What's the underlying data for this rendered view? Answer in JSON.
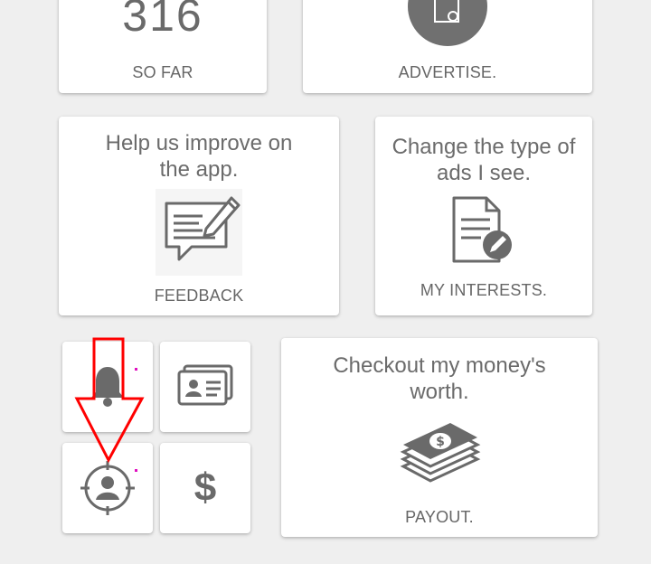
{
  "so_far": {
    "count": "316",
    "label": "SO FAR"
  },
  "advertise": {
    "label": "ADVERTISE."
  },
  "feedback": {
    "title": "Help us improve on the app.",
    "label": "FEEDBACK"
  },
  "interests": {
    "title": "Change the type of ads I see.",
    "label": "MY INTERESTS."
  },
  "payout": {
    "title": "Checkout my money's worth.",
    "label": "PAYOUT."
  },
  "small_tiles": [
    {
      "icon": "bell-icon"
    },
    {
      "icon": "id-card-icon"
    },
    {
      "icon": "profile-target-icon"
    },
    {
      "icon": "dollar-icon",
      "symbol": "$"
    }
  ],
  "colors": {
    "icon": "#666666",
    "annotation": "#ff0000",
    "dot": "#e010c0"
  }
}
